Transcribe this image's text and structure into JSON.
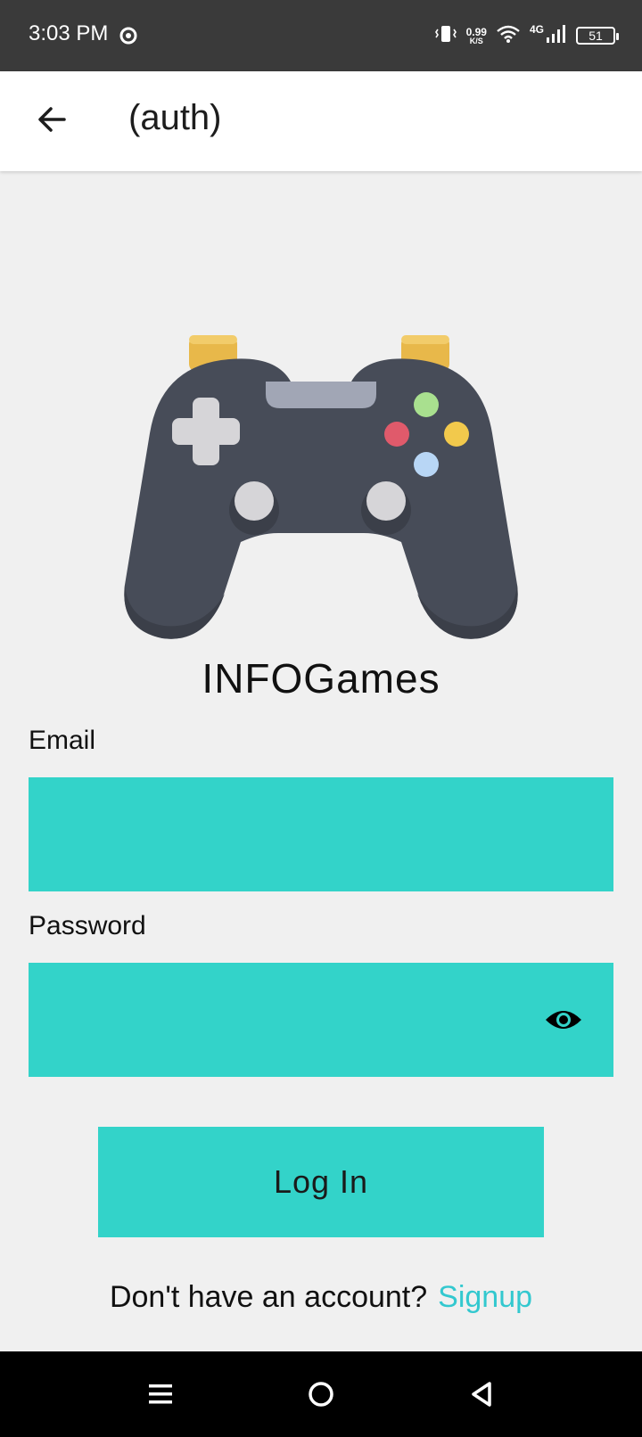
{
  "status_bar": {
    "time": "3:03 PM",
    "net_speed_value": "0.99",
    "net_speed_unit": "K/S",
    "network_type": "4G",
    "battery": "51"
  },
  "app_bar": {
    "title": "(auth)"
  },
  "brand": {
    "name": "INFOGames"
  },
  "form": {
    "email_label": "Email",
    "email_value": "",
    "password_label": "Password",
    "password_value": "",
    "login_label": "Log In"
  },
  "signup": {
    "prompt": "Don't have an account?",
    "link": "Signup"
  },
  "colors": {
    "accent": "#33d3c9",
    "link": "#33c8cf",
    "status_bar_bg": "#3a3a3a",
    "page_bg": "#f0f0f0"
  },
  "icons": [
    "chrome-icon",
    "vibrate-icon",
    "wifi-icon",
    "signal-icon",
    "battery-icon",
    "back-arrow-icon",
    "gamepad-logo",
    "eye-icon",
    "menu-icon",
    "home-icon",
    "back-triangle-icon"
  ]
}
